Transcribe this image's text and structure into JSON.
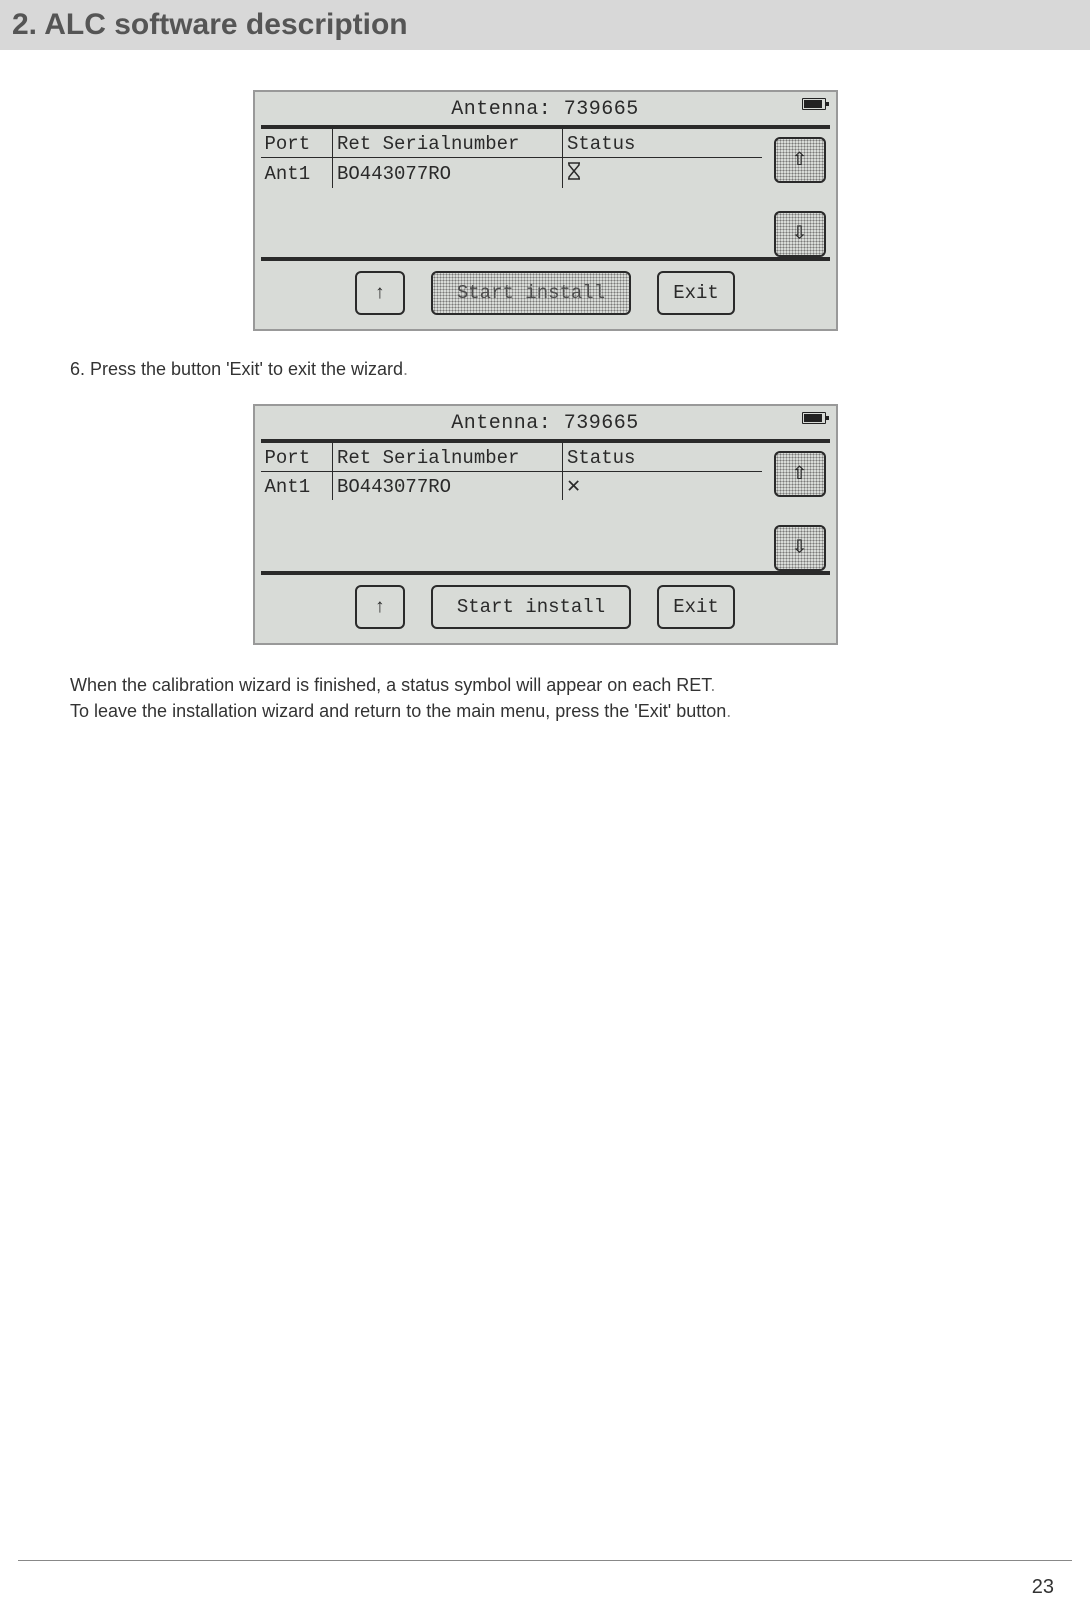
{
  "header": {
    "title": "2. ALC software description"
  },
  "step6_text": "6. Press the button 'Exit' to exit the wizard",
  "step6_dot": ".",
  "screen1": {
    "title": "Antenna: 739665",
    "columns": {
      "port": "Port",
      "serial": "Ret Serialnumber",
      "status": "Status"
    },
    "row": {
      "port": "Ant1",
      "serial": "BO443077RO",
      "status_icon": "hourglass-icon"
    },
    "buttons": {
      "up": "↑",
      "start_install": "Start install",
      "exit": "Exit",
      "scroll_up": "⇧",
      "scroll_down": "⇩"
    }
  },
  "screen2": {
    "title": "Antenna: 739665",
    "columns": {
      "port": "Port",
      "serial": "Ret Serialnumber",
      "status": "Status"
    },
    "row": {
      "port": "Ant1",
      "serial": "BO443077RO",
      "status_icon": "x-icon",
      "status_glyph": "✕"
    },
    "buttons": {
      "up": "↑",
      "start_install": "Start install",
      "exit": "Exit",
      "scroll_up": "⇧",
      "scroll_down": "⇩"
    }
  },
  "closing": {
    "line1": "When the calibration wizard is finished, a status symbol will appear on each RET",
    "line1_dot": ".",
    "line2": "To leave the installation wizard and return to the main menu, press the 'Exit' button",
    "line2_dot": "."
  },
  "page_number": "23"
}
